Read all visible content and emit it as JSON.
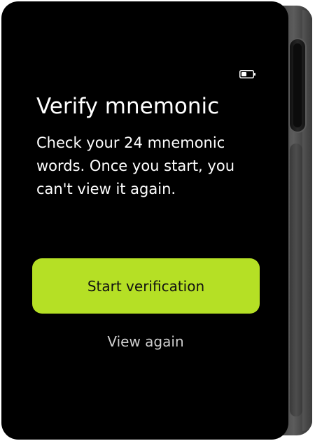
{
  "status_bar": {
    "battery_icon": "battery-icon",
    "battery_color": "#ffffff"
  },
  "screen": {
    "title": "Verify mnemonic",
    "description": "Check your 24 mnemonic words. Once you start, you can't view it again.",
    "primary_button_label": "Start verification",
    "secondary_button_label": "View again"
  },
  "colors": {
    "background": "#000000",
    "accent": "#b5e025",
    "text": "#ffffff",
    "secondary_text": "#cfcfcf"
  }
}
